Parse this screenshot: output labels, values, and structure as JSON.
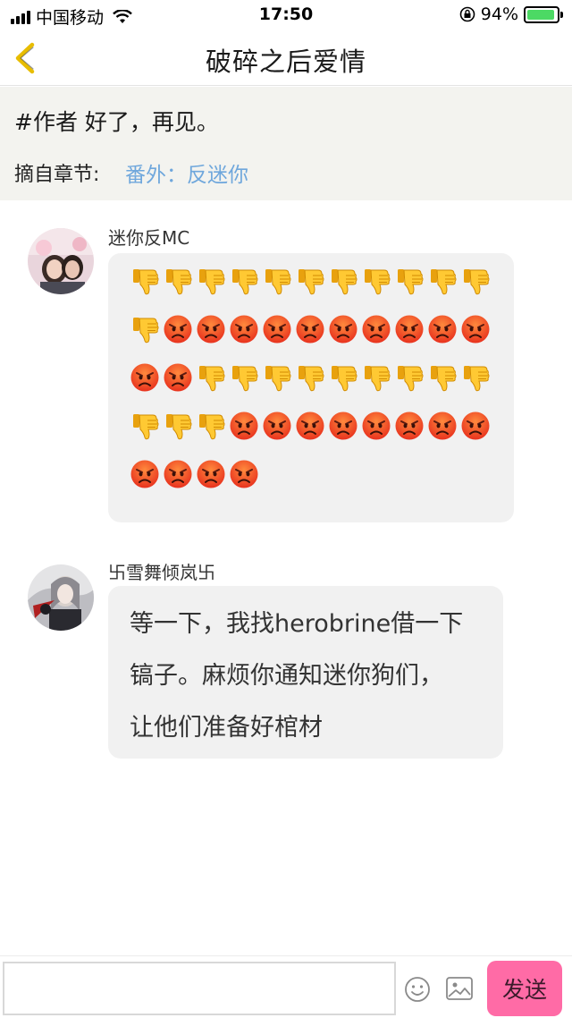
{
  "status_bar": {
    "carrier": "中国移动",
    "time": "17:50",
    "battery": "94%",
    "battery_level": 0.94
  },
  "nav": {
    "title": "破碎之后爱情",
    "back_icon": "chevron-left-icon"
  },
  "quote": {
    "text": "#作者 好了，再见。",
    "chapter_label": "摘自章节:",
    "chapter_name": "番外：反迷你"
  },
  "comments": [
    {
      "username": "迷你反MC",
      "avatar": "avatar-photo",
      "emojis": [
        "thumbs-down",
        "thumbs-down",
        "thumbs-down",
        "thumbs-down",
        "thumbs-down",
        "thumbs-down",
        "thumbs-down",
        "thumbs-down",
        "thumbs-down",
        "thumbs-down",
        "thumbs-down",
        "thumbs-down",
        "angry",
        "angry",
        "angry",
        "angry",
        "angry",
        "angry",
        "angry",
        "angry",
        "angry",
        "angry",
        "angry",
        "angry",
        "thumbs-down",
        "thumbs-down",
        "thumbs-down",
        "thumbs-down",
        "thumbs-down",
        "thumbs-down",
        "thumbs-down",
        "thumbs-down",
        "thumbs-down",
        "thumbs-down",
        "thumbs-down",
        "thumbs-down",
        "angry",
        "angry",
        "angry",
        "angry",
        "angry",
        "angry",
        "angry",
        "angry",
        "angry",
        "angry",
        "angry",
        "angry"
      ]
    },
    {
      "username": "卐雪舞倾岚卐",
      "avatar": "avatar-anime",
      "text_lines": [
        "等一下，我找herobrine借一下",
        "镐子。麻烦你通知迷你狗们，",
        "让他们准备好棺材"
      ]
    }
  ],
  "input_bar": {
    "placeholder": "",
    "emoji_icon": "smiley-icon",
    "image_icon": "image-icon",
    "send_label": "发送"
  },
  "colors": {
    "accent_yellow": "#f2c500",
    "link_blue": "#6fa7dc",
    "send_pink": "#ff6ba6",
    "quote_bg": "#f3f3ef",
    "bubble_bg": "#f1f1f1"
  }
}
